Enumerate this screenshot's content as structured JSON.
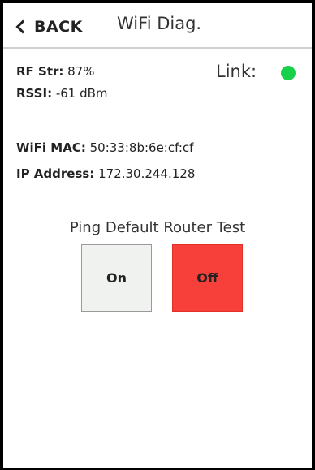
{
  "header": {
    "back_label": "BACK",
    "title": "WiFi Diag."
  },
  "signal": {
    "rf_label": "RF Str:",
    "rf_value": "87%",
    "rssi_label": "RSSI:",
    "rssi_value": "-61 dBm"
  },
  "link": {
    "label": "Link:",
    "status_color": "#19d04a"
  },
  "network": {
    "mac_label": "WiFi MAC:",
    "mac_value": "50:33:8b:6e:cf:cf",
    "ip_label": "IP Address:",
    "ip_value": "172.30.244.128"
  },
  "ping": {
    "title": "Ping Default Router Test",
    "on_label": "On",
    "off_label": "Off",
    "off_color": "#f7403a"
  },
  "icons": {
    "back": "chevron-left-icon",
    "link_status": "status-dot-icon"
  }
}
